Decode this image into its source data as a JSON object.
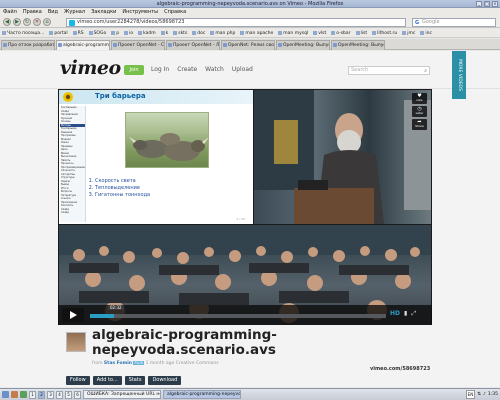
{
  "window": {
    "title": "algebraic-programming-nepeyvoda.scenario.avs on Vimeo - Mozilla Firefox"
  },
  "menu": [
    "Файл",
    "Правка",
    "Вид",
    "Журнал",
    "Закладки",
    "Инструменты",
    "Справка"
  ],
  "browser": {
    "url": "vimeo.com/user2284278/videos/58698723",
    "search_engine": "G",
    "search_placeholder": "Google"
  },
  "bookmarks": [
    "Часто посеща...",
    "portal",
    "RS",
    "SOGo",
    "p",
    "io",
    "kadm",
    "k",
    "skts",
    "doc",
    "man php",
    "man apache",
    "man mysql",
    "vlst",
    "o-sbar",
    "list",
    "lithost.ru",
    "jmc",
    "inc"
  ],
  "tabs": [
    {
      "label": "Про отзок разработчика на зво..."
    },
    {
      "label": "algebraic-programming-nepeyvo...",
      "active": true
    },
    {
      "label": "Проект OpenNet - Сетевые меда..."
    },
    {
      "label": "Проект OpenNet - Лютые, но не..."
    },
    {
      "label": "OpenNet: Релиз свободного м..."
    },
    {
      "label": "OpenMeeting: Выпуск сервера d..."
    },
    {
      "label": "OpenMeeting: Выпуск серверной 3..."
    }
  ],
  "vimeo": {
    "logo": "vimeo",
    "join": "Join",
    "nav": [
      "Log In",
      "Create",
      "Watch",
      "Upload"
    ],
    "search_placeholder": "Search",
    "more_videos": "MORE VIDEOS"
  },
  "player": {
    "slide_title": "Три барьера",
    "slide_sidebar": [
      "Три барьера",
      "Слайд",
      "Направления",
      "Функции",
      "Основы",
      "Методы",
      "Три барьера",
      "Решения",
      "Программы",
      "Модели",
      "Языки",
      "Примеры",
      "Цели",
      "Время",
      "Вычисления",
      "Память",
      "Процессы",
      "Программирование",
      "Сложность",
      "Алгоритмы",
      "Структуры",
      "Задачи",
      "Вывод",
      "Итоги",
      "Вопросы",
      "Литература",
      "Ссылки",
      "Приложение",
      "Контакты",
      "Слайд",
      "Слайд"
    ],
    "slide_list": [
      "Скорость света",
      "Тепловыделение",
      "Гигатонны тоннхода"
    ],
    "slide_page": "2 / 30",
    "icons": [
      {
        "name": "like",
        "symbol": "♥",
        "label": "Like"
      },
      {
        "name": "later",
        "symbol": "◷",
        "label": "Later"
      },
      {
        "name": "share",
        "symbol": "➦",
        "label": "Share"
      }
    ],
    "timecode": "02:32",
    "progress_fraction": 0.08,
    "hd": "HD"
  },
  "video": {
    "title": "algebraic-programming-nepeyvoda.scenario.avs",
    "from_label": "from",
    "author": "Stas Fomin",
    "plus_badge": "PLUS",
    "age": "1 month ago",
    "license": "Creative Commons",
    "vimeo_url": "vimeo.com/58698723",
    "actions": [
      "Follow",
      "Add to...",
      "Stats",
      "Download"
    ]
  },
  "taskbar": {
    "desktops": [
      "1",
      "2",
      "3",
      "4",
      "5",
      "6"
    ],
    "tasks": [
      {
        "label": "ОШИБКА: Запрещенный URL не может..."
      },
      {
        "label": "algebraic-programming-nepeyvoda.sce...",
        "active": true
      }
    ],
    "lang": "EN",
    "time": "1:35"
  }
}
